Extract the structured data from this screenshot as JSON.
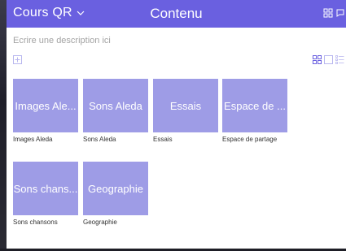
{
  "header": {
    "course": "Cours QR",
    "title": "Contenu",
    "color": "#6a60e0"
  },
  "description_placeholder": "Ecrire une description ici",
  "tile_color": "#9e9ce6",
  "items": [
    {
      "tile": "Images Ale...",
      "caption": "Images Aleda"
    },
    {
      "tile": "Sons Aleda",
      "caption": "Sons Aleda"
    },
    {
      "tile": "Essais",
      "caption": "Essais"
    },
    {
      "tile": "Espace de ...",
      "caption": "Espace de partage"
    },
    {
      "tile": "Sons chans...",
      "caption": "Sons chansons"
    },
    {
      "tile": "Geographie",
      "caption": "Geographie"
    }
  ],
  "icons": {
    "course_dropdown": "chevron-down-icon",
    "header_grid": "grid-icon",
    "header_chat": "chat-icon",
    "add": "plus-icon",
    "view_grid": "grid-view-icon",
    "view_single": "single-view-icon",
    "view_list": "list-view-icon"
  }
}
